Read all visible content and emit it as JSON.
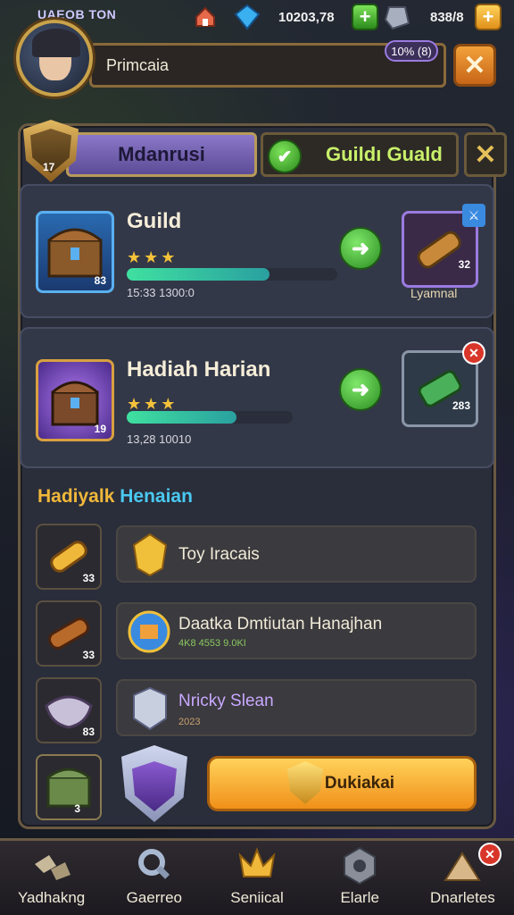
{
  "top": {
    "player_name": "UAEOB TON",
    "gold": "10203,78",
    "gems": "838/8",
    "avatar_level": "10% (8)",
    "name_bar": "Primcaia"
  },
  "tabs": {
    "active": "Mdanrusi",
    "other": "Guildı Guald",
    "shield_num": "17"
  },
  "cards": [
    {
      "title": "Guild",
      "meta": "15:33 1300:0",
      "reward_caption": "Lyamnal",
      "item_num": "83",
      "reward_num": "32",
      "progress": 0.68
    },
    {
      "title": "Hadiah Harian",
      "meta": "13,28 10010",
      "item_num": "19",
      "reward_num": "283",
      "progress": 0.66
    }
  ],
  "section": {
    "title_a": "Hadiyalk",
    "title_b": "Henaian"
  },
  "rows": [
    {
      "text": "Toy Iracais",
      "sub": "",
      "num": "33"
    },
    {
      "text": "Daatka Dmtiutan Hanajhan",
      "sub": "4K8 4553 9.0KI",
      "num": "33"
    },
    {
      "text": "Nricky Slean",
      "sub": "2023",
      "num": "83"
    }
  ],
  "bottom_row": {
    "chest_num": "3"
  },
  "claim_button": "Dukiakai",
  "nav": [
    "Yadhakng",
    "Gaerreo",
    "Seniical",
    "Elarle",
    "Dnarletes"
  ],
  "colors": {
    "accent": "#f0901a",
    "frame": "#6a5a42",
    "green": "#2a8c20"
  }
}
